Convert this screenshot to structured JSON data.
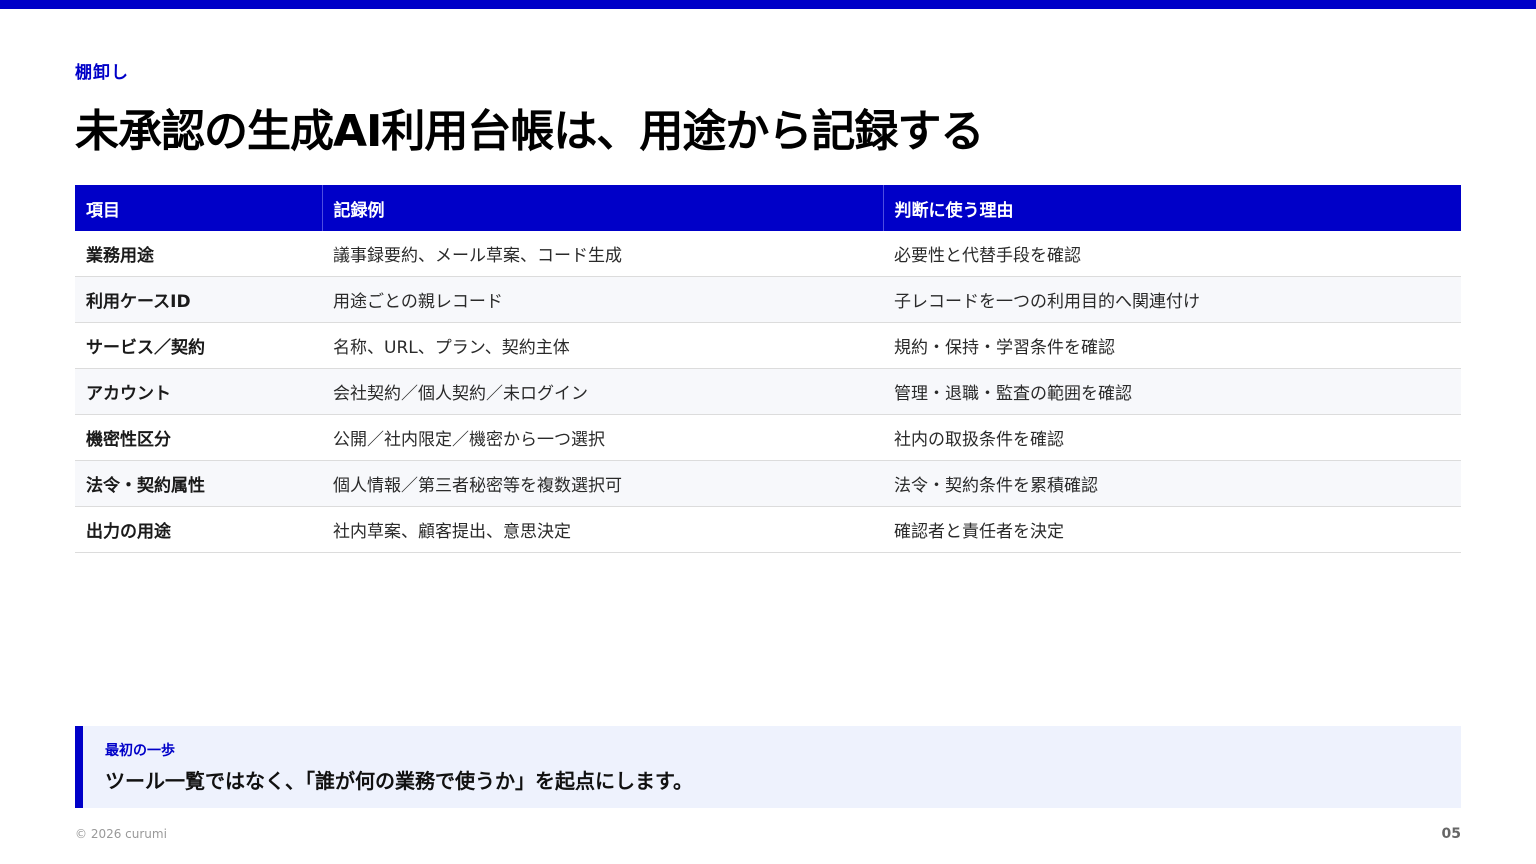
{
  "eyebrow": "棚卸し",
  "title": "未承認の生成AI利用台帳は、用途から記録する",
  "colors": {
    "accent": "#0000c8",
    "callout_bg": "#eef2fd",
    "row_alt": "#f7f8fb"
  },
  "table": {
    "headers": [
      "項目",
      "記録例",
      "判断に使う理由"
    ],
    "rows": [
      {
        "item": "業務用途",
        "example": "議事録要約、メール草案、コード生成",
        "reason": "必要性と代替手段を確認"
      },
      {
        "item": "利用ケースID",
        "example": "用途ごとの親レコード",
        "reason": "子レコードを一つの利用目的へ関連付け"
      },
      {
        "item": "サービス／契約",
        "example": "名称、URL、プラン、契約主体",
        "reason": "規約・保持・学習条件を確認"
      },
      {
        "item": "アカウント",
        "example": "会社契約／個人契約／未ログイン",
        "reason": "管理・退職・監査の範囲を確認"
      },
      {
        "item": "機密性区分",
        "example": "公開／社内限定／機密から一つ選択",
        "reason": "社内の取扱条件を確認"
      },
      {
        "item": "法令・契約属性",
        "example": "個人情報／第三者秘密等を複数選択可",
        "reason": "法令・契約条件を累積確認"
      },
      {
        "item": "出力の用途",
        "example": "社内草案、顧客提出、意思決定",
        "reason": "確認者と責任者を決定"
      }
    ]
  },
  "callout": {
    "label": "最初の一歩",
    "text": "ツール一覧ではなく、「誰が何の業務で使うか」を起点にします。"
  },
  "footer": {
    "copyright": "© 2026 curumi",
    "page_number": "05"
  }
}
